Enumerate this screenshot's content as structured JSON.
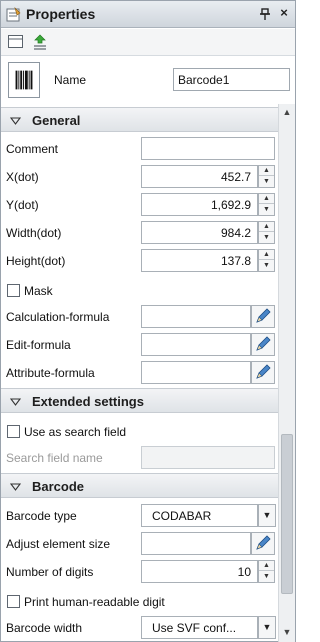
{
  "window": {
    "title": "Properties",
    "pin_icon": "pin-icon",
    "close_symbol": "×"
  },
  "toolbar": {
    "buttons": [
      "categorized-view-icon",
      "sort-icon"
    ]
  },
  "header": {
    "name_label": "Name",
    "name_value": "Barcode1"
  },
  "general": {
    "label": "General",
    "comment_label": "Comment",
    "comment_value": "",
    "x_label": "X(dot)",
    "x_value": "452.7",
    "y_label": "Y(dot)",
    "y_value": "1,692.9",
    "width_label": "Width(dot)",
    "width_value": "984.2",
    "height_label": "Height(dot)",
    "height_value": "137.8",
    "mask_label": "Mask",
    "mask_checked": false,
    "calc_label": "Calculation-formula",
    "calc_value": "",
    "edit_label": "Edit-formula",
    "edit_value": "",
    "attr_label": "Attribute-formula",
    "attr_value": ""
  },
  "extended": {
    "label": "Extended settings",
    "search_label": "Use as search field",
    "search_checked": false,
    "search_name_label": "Search field name",
    "search_name_value": ""
  },
  "barcode": {
    "label": "Barcode",
    "type_label": "Barcode type",
    "type_value": "CODABAR",
    "adjust_label": "Adjust element size",
    "adjust_value": "",
    "digits_label": "Number of digits",
    "digits_value": "10",
    "print_label": "Print human-readable digit",
    "print_checked": false,
    "width_label": "Barcode width",
    "width_value": "Use SVF conf..."
  },
  "colors": {
    "title_bg": "#cfd5dc",
    "section_bg": "#dfe3e7",
    "border": "#a9b0b7"
  }
}
